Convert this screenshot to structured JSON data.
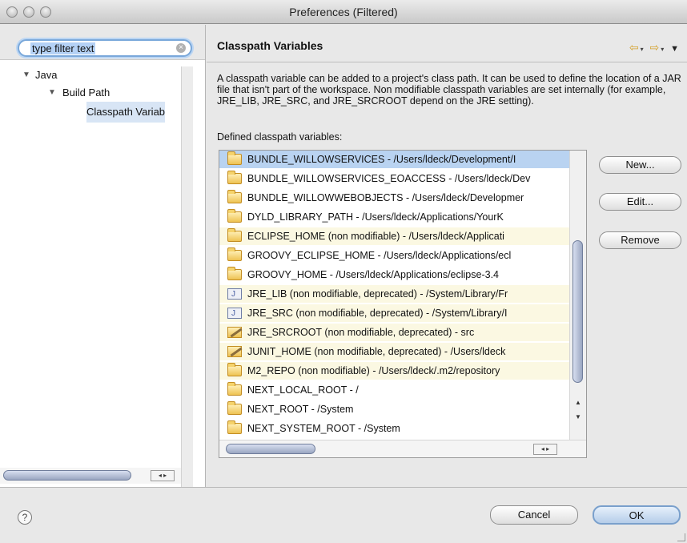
{
  "window": {
    "title": "Preferences (Filtered)"
  },
  "filter": {
    "value": "type filter text"
  },
  "tree": {
    "items": [
      {
        "label": "Java",
        "toggle": "▼"
      },
      {
        "label": "Build Path",
        "toggle": "▼"
      },
      {
        "label": "Classpath Variab"
      }
    ]
  },
  "page": {
    "title": "Classpath Variables",
    "nav": {
      "back": "⇦",
      "forward": "⇨",
      "menu": "▼",
      "dropdown": "▾"
    },
    "description": "A classpath variable can be added to a project's class path. It can be used to define the location of a JAR file that isn't part of the workspace. Non modifiable classpath variables are set internally (for example, JRE_LIB, JRE_SRC, and JRE_SRCROOT depend on the JRE setting).",
    "defined_label": "Defined classpath variables:"
  },
  "variables": [
    {
      "text": "BUNDLE_WILLOWSERVICES - /Users/ldeck/Development/I",
      "icon": "folder",
      "kind": "selected"
    },
    {
      "text": "BUNDLE_WILLOWSERVICES_EOACCESS - /Users/ldeck/Dev",
      "icon": "folder",
      "kind": "normal"
    },
    {
      "text": "BUNDLE_WILLOWWEBOBJECTS - /Users/ldeck/Developmer",
      "icon": "folder",
      "kind": "normal"
    },
    {
      "text": "DYLD_LIBRARY_PATH - /Users/ldeck/Applications/YourK",
      "icon": "folder",
      "kind": "normal"
    },
    {
      "text": "ECLIPSE_HOME (non modifiable) - /Users/ldeck/Applicati",
      "icon": "folder",
      "kind": "nonmod"
    },
    {
      "text": "GROOVY_ECLIPSE_HOME - /Users/ldeck/Applications/ecl",
      "icon": "folder",
      "kind": "normal"
    },
    {
      "text": "GROOVY_HOME - /Users/ldeck/Applications/eclipse-3.4",
      "icon": "folder",
      "kind": "normal"
    },
    {
      "text": "JRE_LIB (non modifiable, deprecated) - /System/Library/Fr",
      "icon": "jar",
      "kind": "nonmod"
    },
    {
      "text": "JRE_SRC (non modifiable, deprecated) - /System/Library/I",
      "icon": "jar",
      "kind": "nonmod"
    },
    {
      "text": "JRE_SRCROOT (non modifiable, deprecated) - src",
      "icon": "pencil",
      "kind": "nonmod"
    },
    {
      "text": "JUNIT_HOME (non modifiable, deprecated) - /Users/ldeck",
      "icon": "pencil",
      "kind": "nonmod"
    },
    {
      "text": "M2_REPO (non modifiable) - /Users/ldeck/.m2/repository",
      "icon": "folder",
      "kind": "nonmod"
    },
    {
      "text": "NEXT_LOCAL_ROOT - /",
      "icon": "folder",
      "kind": "normal"
    },
    {
      "text": "NEXT_ROOT - /System",
      "icon": "folder",
      "kind": "normal"
    },
    {
      "text": "NEXT_SYSTEM_ROOT - /System",
      "icon": "folder",
      "kind": "normal"
    }
  ],
  "buttons": {
    "new": "New...",
    "edit": "Edit...",
    "remove": "Remove",
    "cancel": "Cancel",
    "ok": "OK",
    "help": "?"
  },
  "scroll": {
    "up": "▲",
    "down": "▼",
    "left": "◂",
    "right": "▸",
    "clear": "×"
  },
  "colors": {
    "selection": "#b9d3f1",
    "nonmodifiable_row": "#fbf8e2",
    "nav_arrows": "#d4a12b"
  }
}
